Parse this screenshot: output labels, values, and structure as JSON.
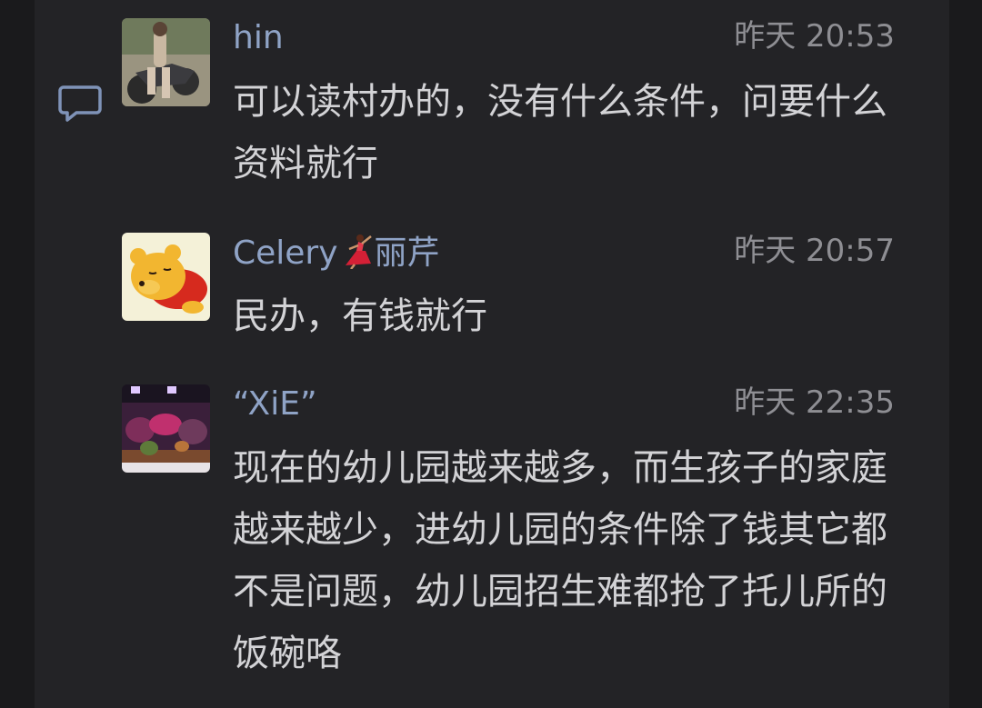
{
  "comments": [
    {
      "author": "hin",
      "time": "昨天 20:53",
      "text": "可以读村办的，没有什么条件，问要什么资料就行",
      "avatar_icon": "motorcycle-photo-avatar"
    },
    {
      "author_prefix": "Celery",
      "author_emoji": "dancer-emoji",
      "author_suffix": "丽芹",
      "time": "昨天 20:57",
      "text": "民办，有钱就行",
      "avatar_icon": "winnie-the-pooh-avatar"
    },
    {
      "author": "“XiE”",
      "time": "昨天 22:35",
      "text": "现在的幼儿园越来越多，而生孩子的家庭越来越少，进幼儿园的条件除了钱其它都不是问题，幼儿园招生难都抢了托儿所的饭碗咯",
      "avatar_icon": "aquarium-photo-avatar"
    }
  ],
  "reply_icon": "comment-bubble-icon",
  "colors": {
    "background": "#1a1a1c",
    "panel": "#232326",
    "author": "#8fa3c6",
    "timestamp": "#8e8e93",
    "text": "#d3d3d6",
    "icon": "#7f93b8"
  }
}
